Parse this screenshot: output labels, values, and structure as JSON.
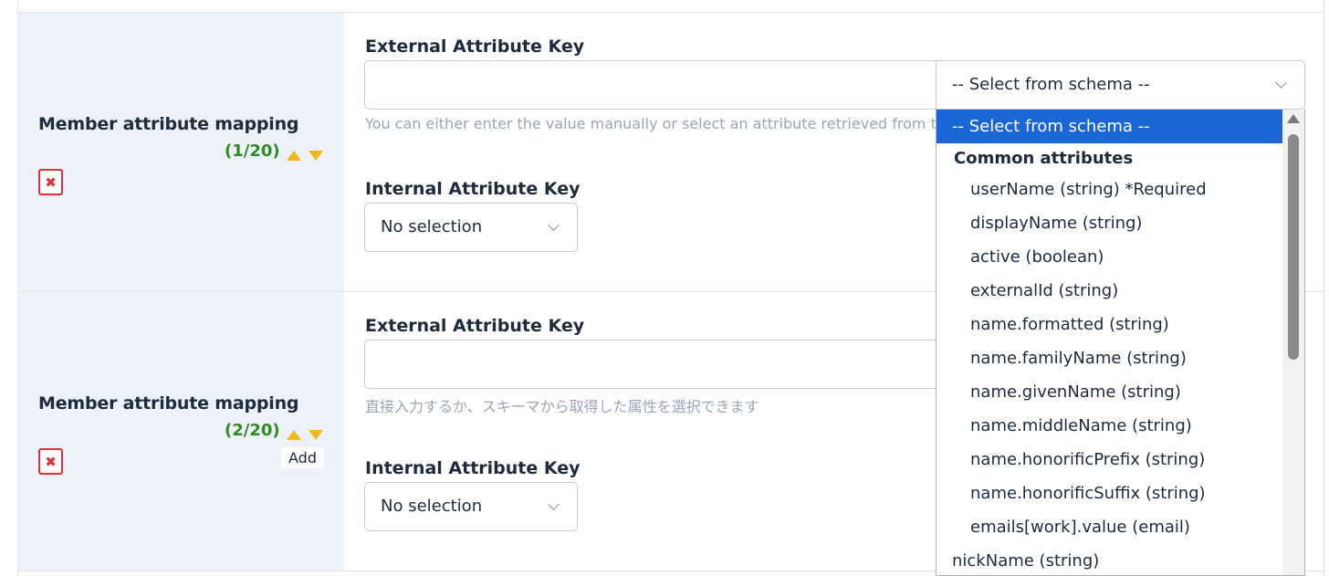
{
  "rows": [
    {
      "title": "Member attribute mapping",
      "counter": "(1/20)",
      "external_label": "External Attribute Key",
      "external_value": "",
      "help": "You can either enter the value manually or select an attribute retrieved from the schema",
      "internal_label": "Internal Attribute Key",
      "internal_value": "No selection"
    },
    {
      "title": "Member attribute mapping",
      "counter": "(2/20)",
      "external_label": "External Attribute Key",
      "external_value": "",
      "help": "直接入力するか、スキーマから取得した属性を選択できます",
      "internal_label": "Internal Attribute Key",
      "internal_value": "No selection",
      "tooltip": "Add"
    }
  ],
  "schema_select": {
    "value": "-- Select from schema --"
  },
  "dropdown": {
    "selected": "-- Select from schema --",
    "group": "Common attributes",
    "options": [
      "userName (string) *Required",
      "displayName (string)",
      "active (boolean)",
      "externalId (string)",
      "name.formatted (string)",
      "name.familyName (string)",
      "name.givenName (string)",
      "name.middleName (string)",
      "name.honorificPrefix (string)",
      "name.honorificSuffix (string)",
      "emails[work].value (email)"
    ],
    "trailing": "nickName (string)"
  },
  "colors": {
    "counter": "#2e8b1f",
    "arrows": "#f3b71e",
    "delete": "#e2303a",
    "selected": "#1a66d6",
    "label_bg": "#edf1f8"
  }
}
